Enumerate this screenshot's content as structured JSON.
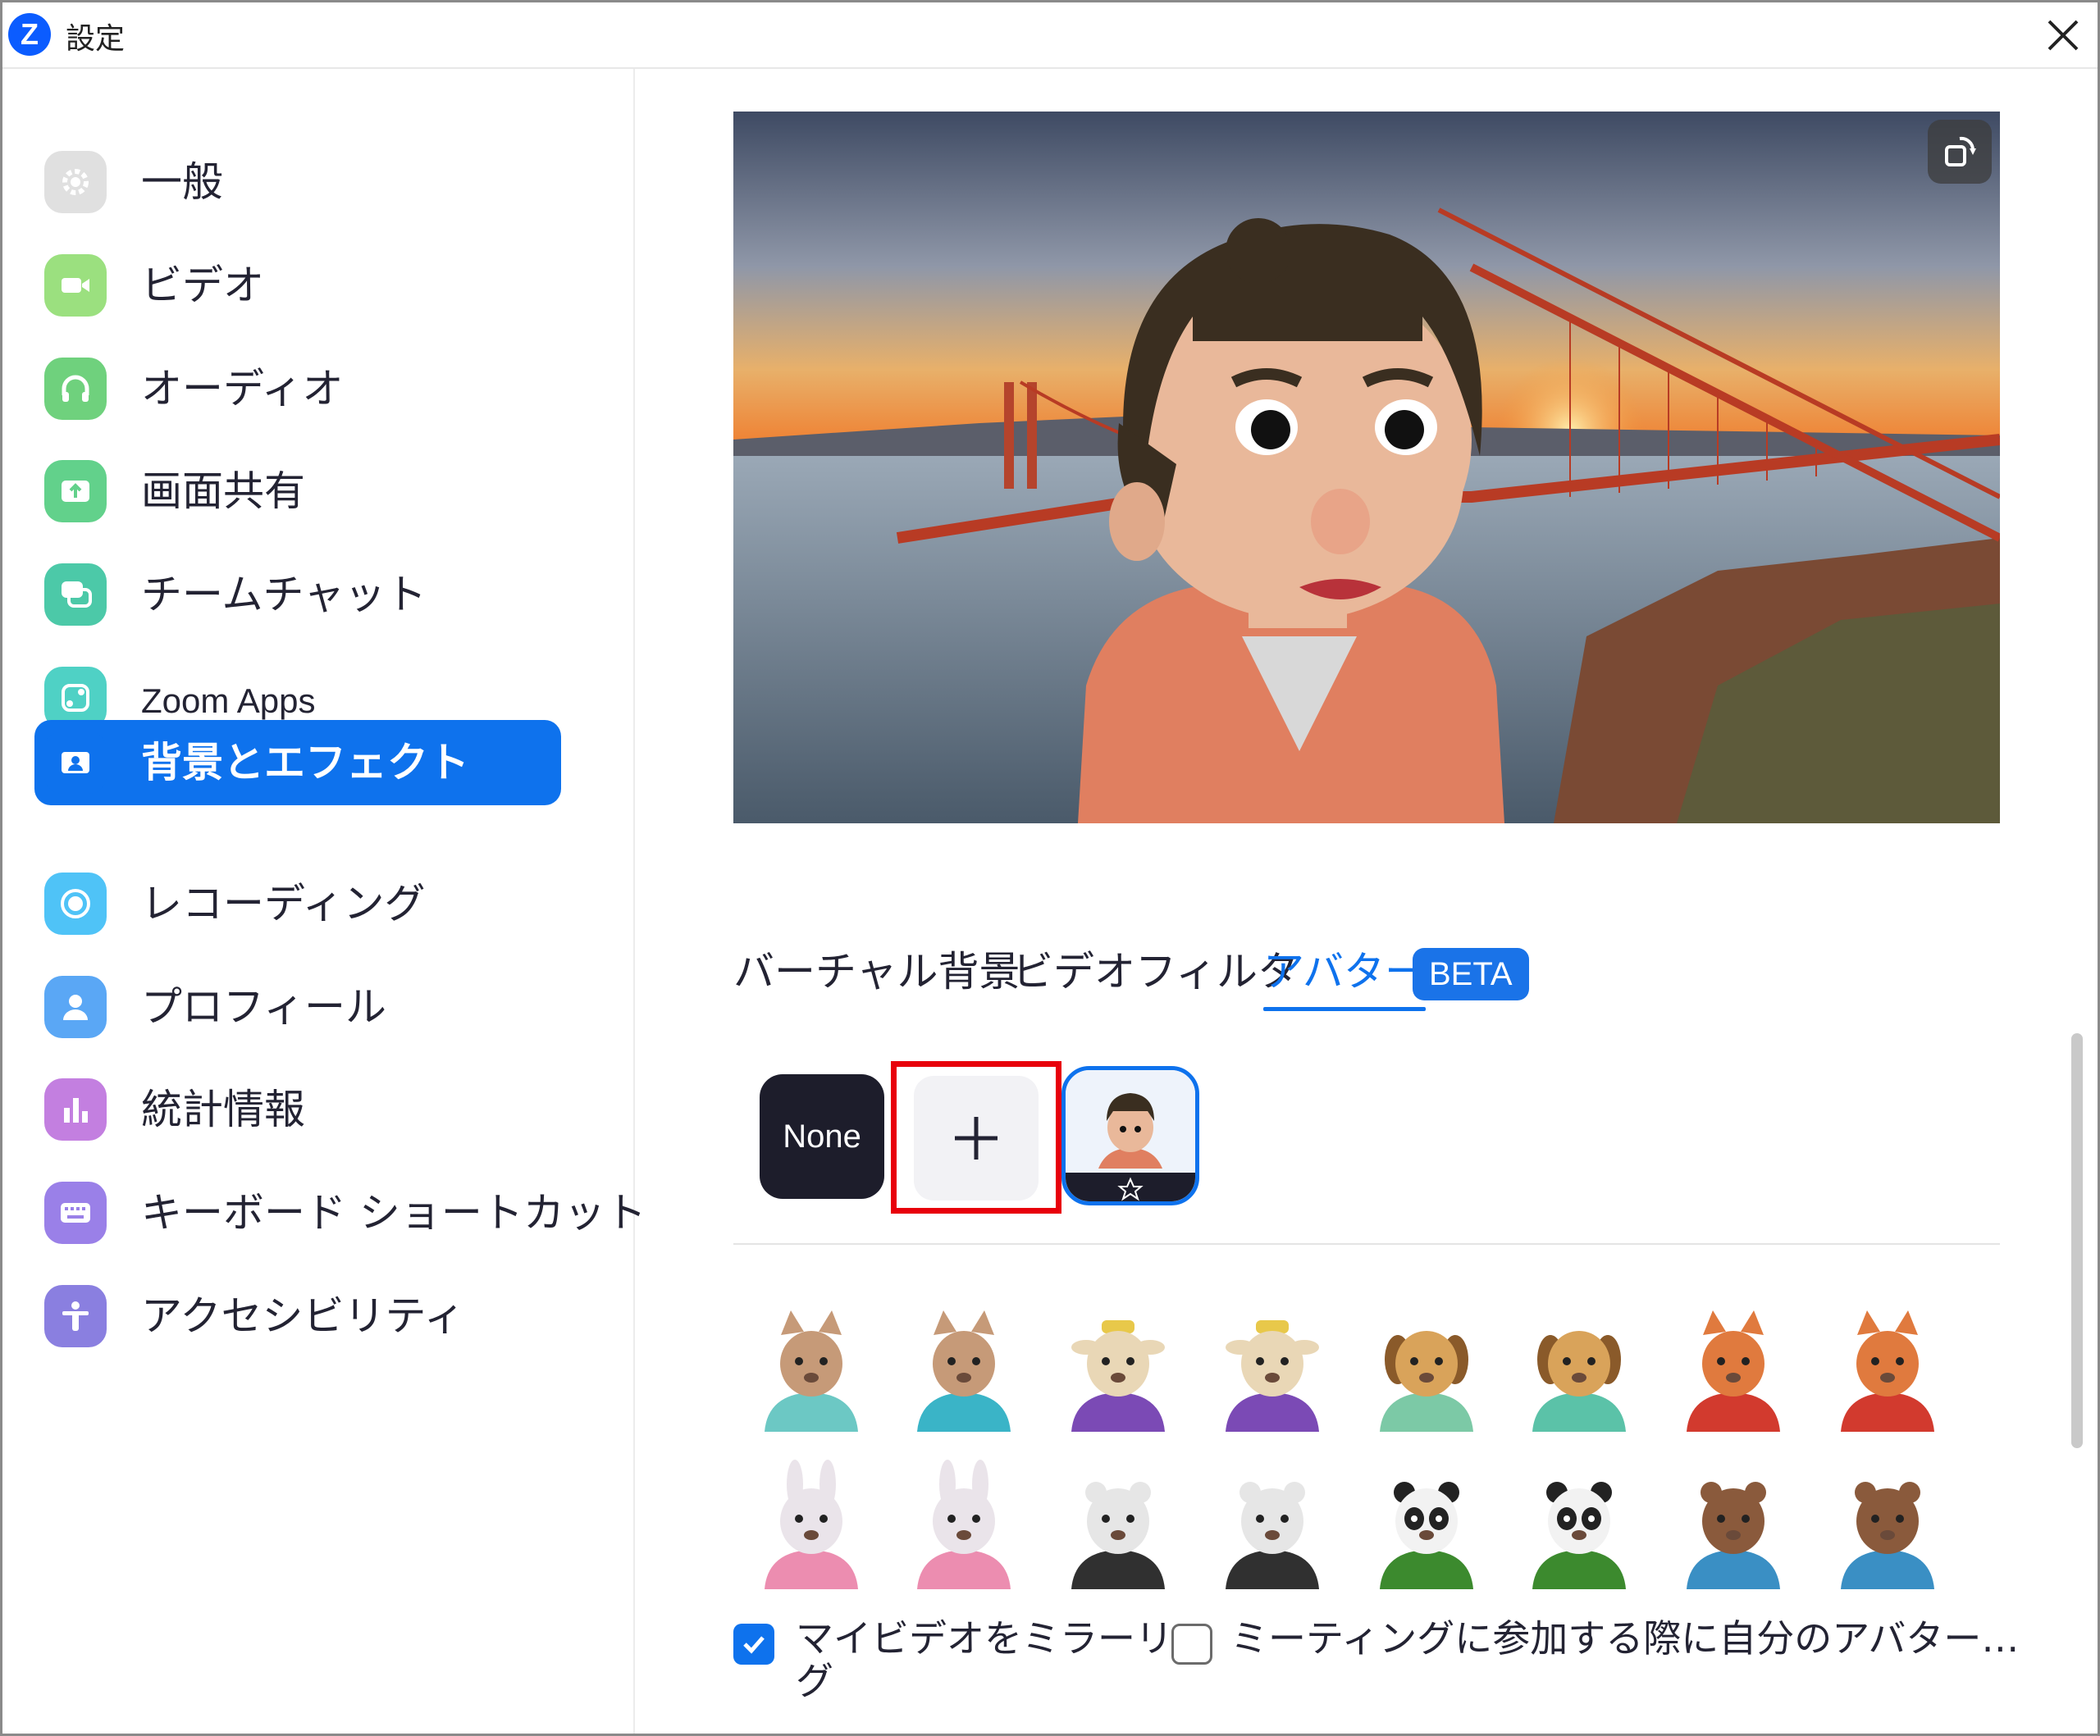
{
  "window": {
    "app_logo": "Z",
    "title": "設定"
  },
  "sidebar": {
    "items": [
      {
        "label": "一般",
        "icon": "gear-icon",
        "color": "#d9d9d9"
      },
      {
        "label": "ビデオ",
        "icon": "video-camera-icon",
        "color": "#9be07f"
      },
      {
        "label": "オーディオ",
        "icon": "headphones-icon",
        "color": "#6fd17d"
      },
      {
        "label": "画面共有",
        "icon": "share-screen-icon",
        "color": "#62d18b"
      },
      {
        "label": "チームチャット",
        "icon": "chat-bubbles-icon",
        "color": "#4cc9a8"
      },
      {
        "label": "Zoom Apps",
        "icon": "apps-icon",
        "color": "#4fd1c5"
      },
      {
        "label": "背景とエフェクト",
        "icon": "portrait-icon",
        "color": "#0e72ed",
        "active": true
      },
      {
        "label": "レコーディング",
        "icon": "record-icon",
        "color": "#4fc3f7"
      },
      {
        "label": "プロフィール",
        "icon": "person-icon",
        "color": "#5aa7f5"
      },
      {
        "label": "統計情報",
        "icon": "bar-chart-icon",
        "color": "#c37fe0"
      },
      {
        "label": "キーボード ショートカット",
        "icon": "keyboard-icon",
        "color": "#9a80e8"
      },
      {
        "label": "アクセシビリティ",
        "icon": "accessibility-icon",
        "color": "#8a7fe0"
      }
    ]
  },
  "tabs": [
    {
      "label": "バーチャル背景",
      "active": false
    },
    {
      "label": "ビデオフィルタ",
      "active": false
    },
    {
      "label": "アバター",
      "active": true
    }
  ],
  "beta_badge": "BETA",
  "avatar_selection": {
    "none_label": "None",
    "add_label": "+"
  },
  "avatars": [
    {
      "name": "cat-avatar",
      "face": "#c69a78",
      "shirt": "#6cc8c4"
    },
    {
      "name": "cat-avatar",
      "face": "#c69a78",
      "shirt": "#3ab4c7"
    },
    {
      "name": "cow-avatar",
      "face": "#e9d7b6",
      "shirt": "#7b4ab5"
    },
    {
      "name": "cow-avatar",
      "face": "#e9d7b6",
      "shirt": "#7b4ab5"
    },
    {
      "name": "dog-avatar",
      "face": "#d9a35a",
      "shirt": "#7cc9a6"
    },
    {
      "name": "dog-avatar",
      "face": "#d9a35a",
      "shirt": "#5bc2a8"
    },
    {
      "name": "fox-avatar",
      "face": "#e07a3e",
      "shirt": "#d23a2e"
    },
    {
      "name": "fox-avatar",
      "face": "#e07a3e",
      "shirt": "#d23a2e"
    },
    {
      "name": "rabbit-avatar",
      "face": "#eae4ea",
      "shirt": "#ec8db0"
    },
    {
      "name": "rabbit-avatar",
      "face": "#eae4ea",
      "shirt": "#ec8db0"
    },
    {
      "name": "bear-avatar",
      "face": "#e6e6e6",
      "shirt": "#303030"
    },
    {
      "name": "bear-avatar",
      "face": "#e6e6e6",
      "shirt": "#303030"
    },
    {
      "name": "panda-avatar",
      "face": "#f2f2f2",
      "shirt": "#3c8a2e"
    },
    {
      "name": "panda-avatar",
      "face": "#f2f2f2",
      "shirt": "#3c8a2e"
    },
    {
      "name": "otter-avatar",
      "face": "#8a5a3c",
      "shirt": "#3a8fc4"
    },
    {
      "name": "otter-avatar",
      "face": "#8a5a3c",
      "shirt": "#3a8fc4"
    }
  ],
  "options": {
    "mirror_label_line1": "マイビデオをミラーリン",
    "mirror_label_line2": "グ",
    "mirror_checked": true,
    "join_with_avatar_label": "ミーティングに参加する際に自分のアバター…",
    "join_with_avatar_checked": false
  }
}
